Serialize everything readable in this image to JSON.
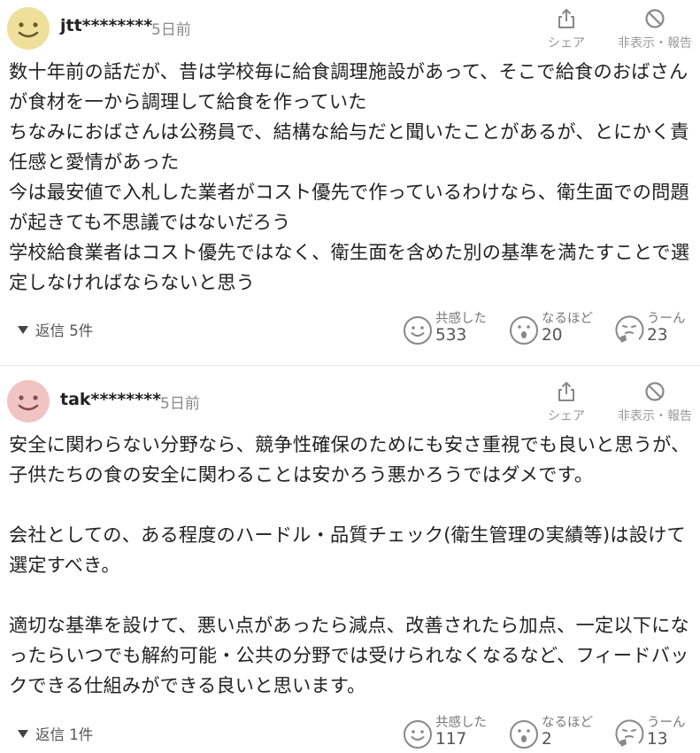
{
  "comments": [
    {
      "username": "jtt********",
      "time": "5日前",
      "share_label": "シェア",
      "hide_label": "非表示・報告",
      "avatar_icon": "smile-face-yellow",
      "paragraphs": [
        "数十年前の話だが、昔は学校毎に給食調理施設があって、そこで給食のおばさんが食材を一から調理して給食を作っていた",
        "ちなみにおばさんは公務員で、結構な給与だと聞いたことがあるが、とにかく責任感と愛情があった",
        "今は最安値で入札した業者がコスト優先で作っているわけなら、衛生面での問題が起きても不思議ではないだろう",
        "学校給食業者はコスト優先ではなく、衛生面を含めた別の基準を満たすことで選定しなければならないと思う"
      ],
      "replies_label": "返信 5件",
      "reactions": [
        {
          "label": "共感した",
          "count": "533",
          "icon": "smile-icon"
        },
        {
          "label": "なるほど",
          "count": "20",
          "icon": "surprised-icon"
        },
        {
          "label": "うーん",
          "count": "23",
          "icon": "thinking-icon"
        }
      ]
    },
    {
      "username": "tak********",
      "time": "5日前",
      "share_label": "シェア",
      "hide_label": "非表示・報告",
      "avatar_icon": "smile-face-pink",
      "paragraphs": [
        "安全に関わらない分野なら、競争性確保のためにも安さ重視でも良いと思うが、子供たちの食の安全に関わることは安かろう悪かろうではダメです。",
        "",
        "会社としての、ある程度のハードル・品質チェック(衛生管理の実績等)は設けて選定すべき。",
        "",
        "適切な基準を設けて、悪い点があったら減点、改善されたら加点、一定以下になったらいつでも解約可能・公共の分野では受けられなくなるなど、フィードバックできる仕組みができる良いと思います。"
      ],
      "replies_label": "返信 1件",
      "reactions": [
        {
          "label": "共感した",
          "count": "117",
          "icon": "smile-icon"
        },
        {
          "label": "なるほど",
          "count": "2",
          "icon": "surprised-icon"
        },
        {
          "label": "うーん",
          "count": "13",
          "icon": "thinking-icon"
        }
      ]
    }
  ]
}
